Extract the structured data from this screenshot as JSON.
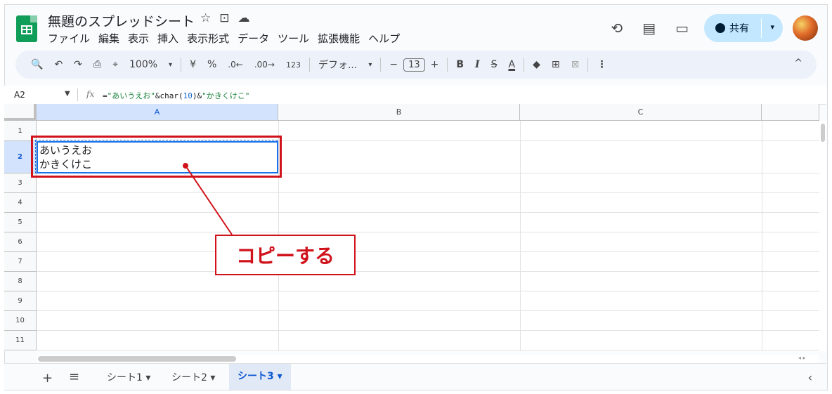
{
  "app": {
    "title": "無題のスプレッドシート",
    "title_icons": [
      "☆",
      "⊡",
      "☁"
    ],
    "menu": [
      "ファイル",
      "編集",
      "表示",
      "挿入",
      "表示形式",
      "データ",
      "ツール",
      "拡張機能",
      "ヘルプ"
    ],
    "share_label": "共有",
    "header_icons": [
      "⟲",
      "▤",
      "▭"
    ]
  },
  "toolbar": {
    "items": [
      "🔍",
      "↶",
      "↷",
      "⎙",
      "⌖",
      "100%",
      "▾",
      "¥",
      "%",
      ".0",
      "←",
      ".00",
      "123",
      "デフォ...",
      "▾",
      "−",
      "13",
      "+",
      "B",
      "I",
      "S",
      "A",
      "◆",
      "⊞",
      "⊠",
      "⋮"
    ],
    "zoom": "100%",
    "currency": "¥",
    "percent": "%",
    "dec_down": ".0←",
    "dec_up": ".00→",
    "format123": "123",
    "font": "デフォ...",
    "font_size": "13",
    "minus": "−",
    "plus": "+",
    "bold": "B",
    "italic": "I",
    "strike": "S",
    "textcolor": "A",
    "more": "⋮",
    "collapse": "^"
  },
  "formula_bar": {
    "name_box": "A2",
    "fx": "fx",
    "formula_parts": [
      {
        "text": "=",
        "kind": "op"
      },
      {
        "text": "\"あいうえお\"",
        "kind": "str"
      },
      {
        "text": "&char(",
        "kind": "op"
      },
      {
        "text": "10",
        "kind": "num"
      },
      {
        "text": ")&",
        "kind": "op"
      },
      {
        "text": "\"かきくけこ\"",
        "kind": "str"
      }
    ]
  },
  "grid": {
    "columns": [
      "A",
      "B",
      "C"
    ],
    "rows": [
      "1",
      "2",
      "3",
      "4",
      "5",
      "6",
      "7",
      "8",
      "9",
      "10",
      "11"
    ],
    "cell_a2_line1": "あいうえお",
    "cell_a2_line2": "かきくけこ"
  },
  "annotation": {
    "callout": "コピーする",
    "color": "#d0121b"
  },
  "sheets": {
    "add": "+",
    "list": "≡",
    "tabs": [
      "シート1",
      "シート2",
      "シート3"
    ],
    "active_index": 2,
    "collapse": "‹"
  }
}
